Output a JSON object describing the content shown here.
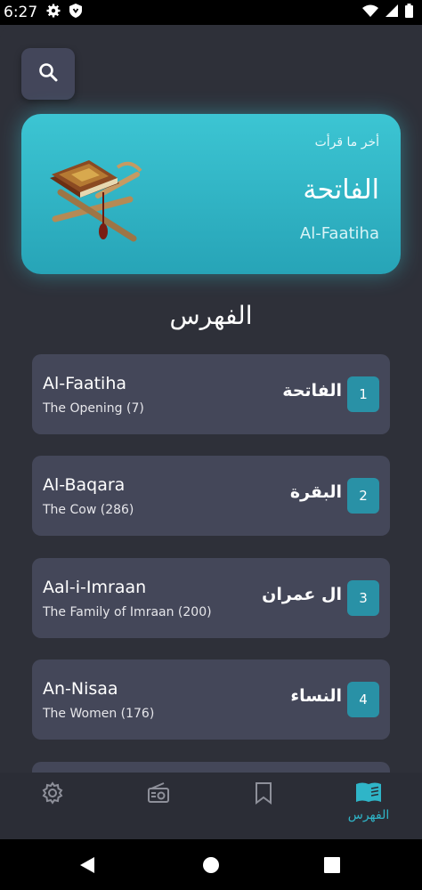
{
  "status": {
    "time": "6:27"
  },
  "last_read": {
    "subtitle": "أخر ما قرأت",
    "title_ar": "الفاتحة",
    "title_latin": "Al-Faatiha"
  },
  "index_title": "الفهرس",
  "surahs": [
    {
      "number": "1",
      "name_latin": "Al-Faatiha",
      "name_en": "The Opening (7)",
      "name_ar": "الفاتحة"
    },
    {
      "number": "2",
      "name_latin": "Al-Baqara",
      "name_en": "The Cow (286)",
      "name_ar": "البقرة"
    },
    {
      "number": "3",
      "name_latin": "Aal-i-Imraan",
      "name_en": "The Family of Imraan (200)",
      "name_ar": "ال عمران"
    },
    {
      "number": "4",
      "name_latin": "An-Nisaa",
      "name_en": "The Women (176)",
      "name_ar": "النساء"
    }
  ],
  "bottom_nav": {
    "items": [
      {
        "icon": "gear-icon"
      },
      {
        "icon": "radio-icon"
      },
      {
        "icon": "bookmark-icon"
      },
      {
        "icon": "book-open-icon",
        "label": "الفهرس",
        "active": true
      }
    ]
  },
  "colors": {
    "accent": "#2fb5c8",
    "card": "#31b3c4",
    "background": "#2e3039",
    "row": "#444759"
  }
}
